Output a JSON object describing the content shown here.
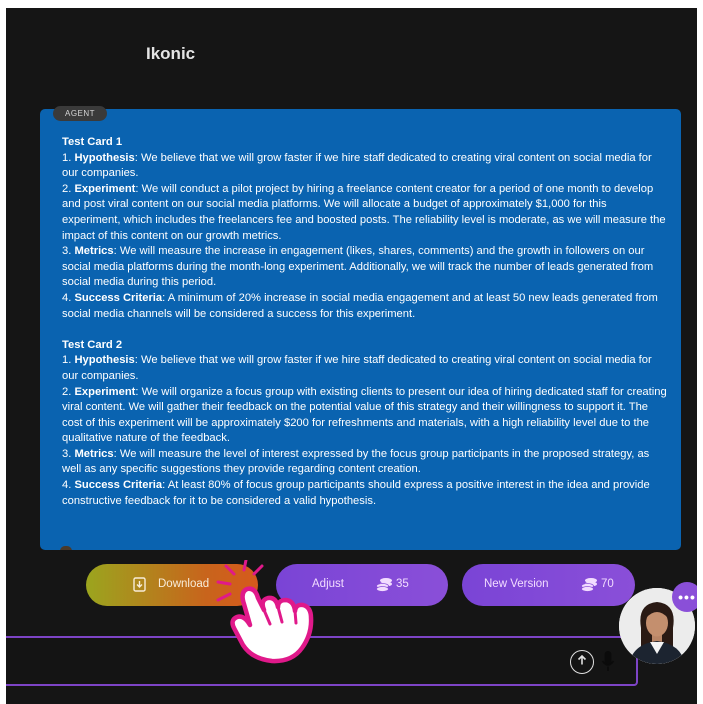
{
  "app": {
    "title": "Ikonic"
  },
  "message": {
    "tag": "AGENT",
    "cards": [
      {
        "title": "Test Card 1",
        "items": [
          {
            "prefix": "1. ",
            "label": "Hypothesis",
            "text": ": We believe that we will grow faster if we hire staff dedicated to creating viral content on social media for our companies."
          },
          {
            "prefix": "2. ",
            "label": "Experiment",
            "text": ": We will conduct a pilot project by hiring a freelance content creator for a period of one month to develop and post viral content on our social media platforms. We will allocate a budget of approximately $1,000 for this experiment, which includes the freelancers fee and boosted posts. The reliability level is moderate, as we will measure the impact of this content on our growth metrics."
          },
          {
            "prefix": "3. ",
            "label": "Metrics",
            "text": ": We will measure the increase in engagement (likes, shares, comments) and the growth in followers on our social media platforms during the month-long experiment. Additionally, we will track the number of leads generated from social media during this period."
          },
          {
            "prefix": "4. ",
            "label": "Success Criteria",
            "text": ": A minimum of 20% increase in social media engagement and at least 50 new leads generated from social media channels will be considered a success for this experiment."
          }
        ]
      },
      {
        "title": "Test Card 2",
        "items": [
          {
            "prefix": "1. ",
            "label": "Hypothesis",
            "text": ": We believe that we will grow faster if we hire staff dedicated to creating viral content on social media for our companies."
          },
          {
            "prefix": "2. ",
            "label": "Experiment",
            "text": ": We will organize a focus group with existing clients to present our idea of hiring dedicated staff for creating viral content. We will gather their feedback on the potential value of this strategy and their willingness to support it. The cost of this experiment will be approximately $200 for refreshments and materials, with a high reliability level due to the qualitative nature of the feedback."
          },
          {
            "prefix": "3. ",
            "label": "Metrics",
            "text": ": We will measure the level of interest expressed by the focus group participants in the proposed strategy, as well as any specific suggestions they provide regarding content creation."
          },
          {
            "prefix": "4. ",
            "label": "Success Criteria",
            "text": ": At least 80% of focus group participants should express a positive interest in the idea and provide constructive feedback for it to be considered a valid hypothesis."
          }
        ]
      }
    ]
  },
  "actions": {
    "download": {
      "label": "Download"
    },
    "adjust": {
      "label": "Adjust",
      "cost": "35"
    },
    "new_version": {
      "label": "New Version",
      "cost": "70"
    }
  },
  "colors": {
    "message_bg": "#0a63b0",
    "accent_purple": "#8a4fd8",
    "hand_pink": "#e0198a"
  },
  "icons": [
    "download-icon",
    "coins-icon",
    "arrow-up-icon",
    "microphone-icon",
    "chat-dots-icon",
    "tap-hand-icon"
  ]
}
